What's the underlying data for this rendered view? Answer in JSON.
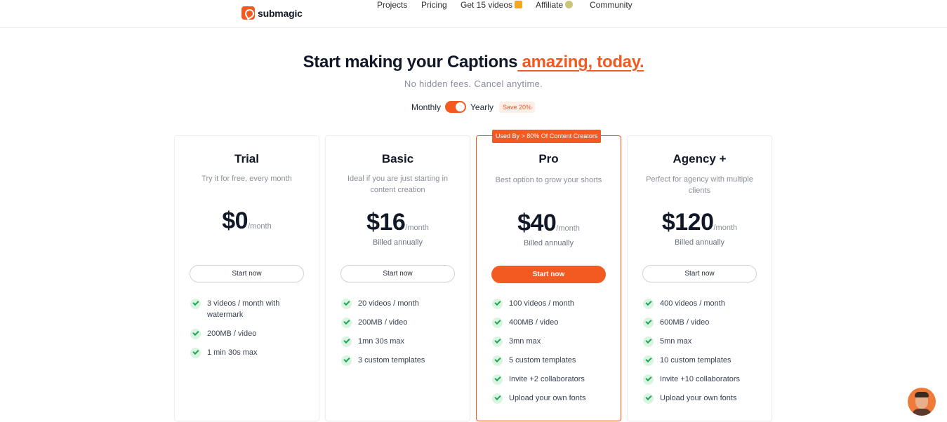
{
  "header": {
    "logo_text": "submagic",
    "nav": [
      {
        "label": "Projects"
      },
      {
        "label": "Pricing"
      },
      {
        "label": "Get 15 videos",
        "icon": "gift-icon"
      },
      {
        "label": "Affiliate",
        "icon": "badge-icon"
      },
      {
        "label": "Community"
      }
    ]
  },
  "hero": {
    "title_main": "Start making your Captions",
    "title_accent": " amazing, today.",
    "subtitle": "No hidden fees. Cancel anytime."
  },
  "billing": {
    "monthly_label": "Monthly",
    "yearly_label": "Yearly",
    "save_badge": "Save 20%",
    "selected": "Yearly"
  },
  "plans": [
    {
      "name": "Trial",
      "description": "Try it for free, every month",
      "price": "$0",
      "period": "/month",
      "billed": "",
      "cta": "Start now",
      "features": [
        "3 videos / month with watermark",
        "200MB / video",
        "1 min 30s max"
      ]
    },
    {
      "name": "Basic",
      "description": "Ideal if you are just starting in content creation",
      "price": "$16",
      "period": "/month",
      "billed": "Billed annually",
      "cta": "Start now",
      "features": [
        "20 videos / month",
        "200MB / video",
        "1mn 30s max",
        "3 custom templates"
      ]
    },
    {
      "name": "Pro",
      "badge": "Used By > 80% Of Content Creators",
      "description": "Best option to grow your shorts",
      "price": "$40",
      "period": "/month",
      "billed": "Billed annually",
      "cta": "Start now",
      "features": [
        "100 videos / month",
        "400MB / video",
        "3mn max",
        "5 custom templates",
        "Invite +2 collaborators",
        "Upload your own fonts"
      ]
    },
    {
      "name": "Agency +",
      "description": "Perfect for agency with multiple clients",
      "price": "$120",
      "period": "/month",
      "billed": "Billed annually",
      "cta": "Start now",
      "features": [
        "400 videos / month",
        "600MB / video",
        "5mn max",
        "10 custom templates",
        "Invite +10 collaborators",
        "Upload your own fonts"
      ]
    }
  ],
  "colors": {
    "accent": "#f25a22",
    "check_bg": "#d9f4e0",
    "check": "#22a55a"
  }
}
